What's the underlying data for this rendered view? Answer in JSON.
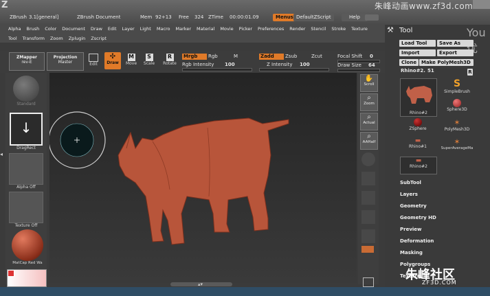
{
  "titlebar": {
    "app": "ZBrush",
    "version": "3.1[general]",
    "doc": "ZBrush Document",
    "mem": "Mem",
    "mem_value": "92+13",
    "free": "Free",
    "free_value": "324",
    "ztime": "ZTime",
    "ztime_value": "00:00:01.09",
    "menus_btn": "Menus",
    "default_script": "DefaultZScript",
    "help": "Help",
    "watermark": "朱峰动画www.zf3d.com"
  },
  "menus": {
    "row1": [
      "Alpha",
      "Brush",
      "Color",
      "Document",
      "Draw",
      "Edit",
      "Layer",
      "Light",
      "Macro",
      "Marker",
      "Material",
      "Movie",
      "Picker",
      "Preferences",
      "Render",
      "Stencil",
      "Stroke",
      "Texture"
    ],
    "row2": [
      "Tool",
      "Transform",
      "Zoom",
      "Zplugin",
      "Zscript"
    ]
  },
  "toolbar": {
    "zmapper": "ZMapper",
    "zmapper_sub": "rev-E",
    "projection": "Projection",
    "projection_sub": "Master",
    "edit": "Edit",
    "draw": "Draw",
    "move": "Move",
    "scale": "Scale",
    "rotate": "Rotate",
    "mrgb": "Mrgb",
    "rgb": "Rgb",
    "m": "M",
    "rgb_intensity_label": "Rgb Intensity",
    "rgb_intensity_value": "100",
    "zadd": "Zadd",
    "zsub": "Zsub",
    "zcut": "Zcut",
    "z_intensity_label": "Z Intensity",
    "z_intensity_value": "100",
    "focal_shift_label": "Focal Shift",
    "focal_shift_value": "0",
    "draw_size_label": "Draw Size",
    "draw_size_value": "64"
  },
  "leftshelf": {
    "standard": "Standard",
    "dragrect": "DragRect",
    "alpha": "Alpha Off",
    "texture": "Texture Off",
    "matcap": "MatCap Red Wa"
  },
  "rightshelf": {
    "scroll": "Scroll",
    "zoom": "Zoom",
    "actual": "Actual",
    "aahalf": "AAHalf"
  },
  "panel": {
    "title": "Tool",
    "load_tool": "Load Tool",
    "save_as": "Save As",
    "import": "Import",
    "export": "Export",
    "clone": "Clone",
    "make_polymesh": "Make PolyMesh3D",
    "current_tool": "Rhino#2.",
    "current_tool_count": "51",
    "r_btn": "R",
    "thumbs": [
      {
        "label": "Rhino#2"
      },
      {
        "label": "SimpleBrush"
      },
      {
        "label": "Sphere3D"
      },
      {
        "label": "ZSphere"
      },
      {
        "label": "PolyMesh3D"
      },
      {
        "label": "Rhino#1"
      },
      {
        "label": "SuperAverageMa"
      },
      {
        "label": "Rhino#2"
      }
    ],
    "sections": [
      "SubTool",
      "Layers",
      "Geometry",
      "Geometry HD",
      "Preview",
      "Deformation",
      "Masking",
      "Polygroups",
      "Texture"
    ]
  },
  "watermark_bottom": {
    "cn": "朱峰社区",
    "url": "ZF3D.COM"
  },
  "colors": {
    "accent": "#e07a28",
    "model": "#b9563b"
  }
}
